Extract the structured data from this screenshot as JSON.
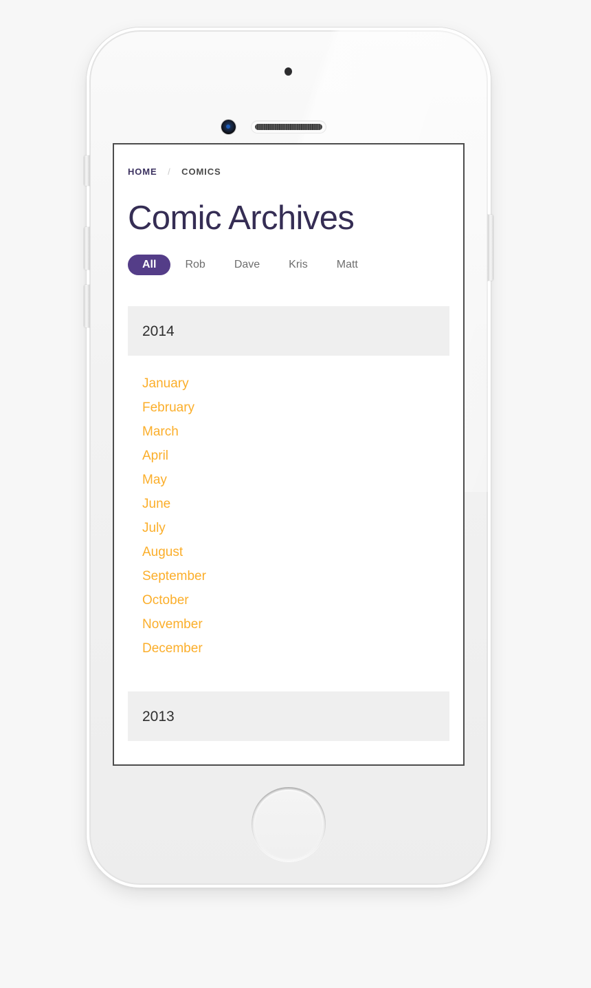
{
  "device": {
    "type": "smartphone-mockup",
    "color": "white",
    "hardware": {
      "sensor": "proximity-sensor",
      "camera": "front-camera",
      "speaker": "earpiece-speaker",
      "home": "home-button",
      "silent_switch": "silent-switch",
      "volume_up": "volume-up-button",
      "volume_down": "volume-down-button",
      "power": "power-button"
    }
  },
  "colors": {
    "background": "#f7f7f7",
    "screen": "#ffffff",
    "accent_purple": "#543d88",
    "title_navy": "#352d54",
    "link_orange": "#fbae2a",
    "year_bar_grey": "#efefef",
    "tab_inactive_grey": "#6e6e6e"
  },
  "breadcrumb": {
    "home": "HOME",
    "separator": "/",
    "current": "COMICS"
  },
  "page": {
    "title": "Comic Archives"
  },
  "filters": {
    "tabs": [
      {
        "label": "All",
        "active": true
      },
      {
        "label": "Rob",
        "active": false
      },
      {
        "label": "Dave",
        "active": false
      },
      {
        "label": "Kris",
        "active": false
      },
      {
        "label": "Matt",
        "active": false
      }
    ]
  },
  "archives": [
    {
      "year": "2014",
      "months": [
        "January",
        "February",
        "March",
        "April",
        "May",
        "June",
        "July",
        "August",
        "September",
        "October",
        "November",
        "December"
      ]
    },
    {
      "year": "2013",
      "months": []
    }
  ]
}
